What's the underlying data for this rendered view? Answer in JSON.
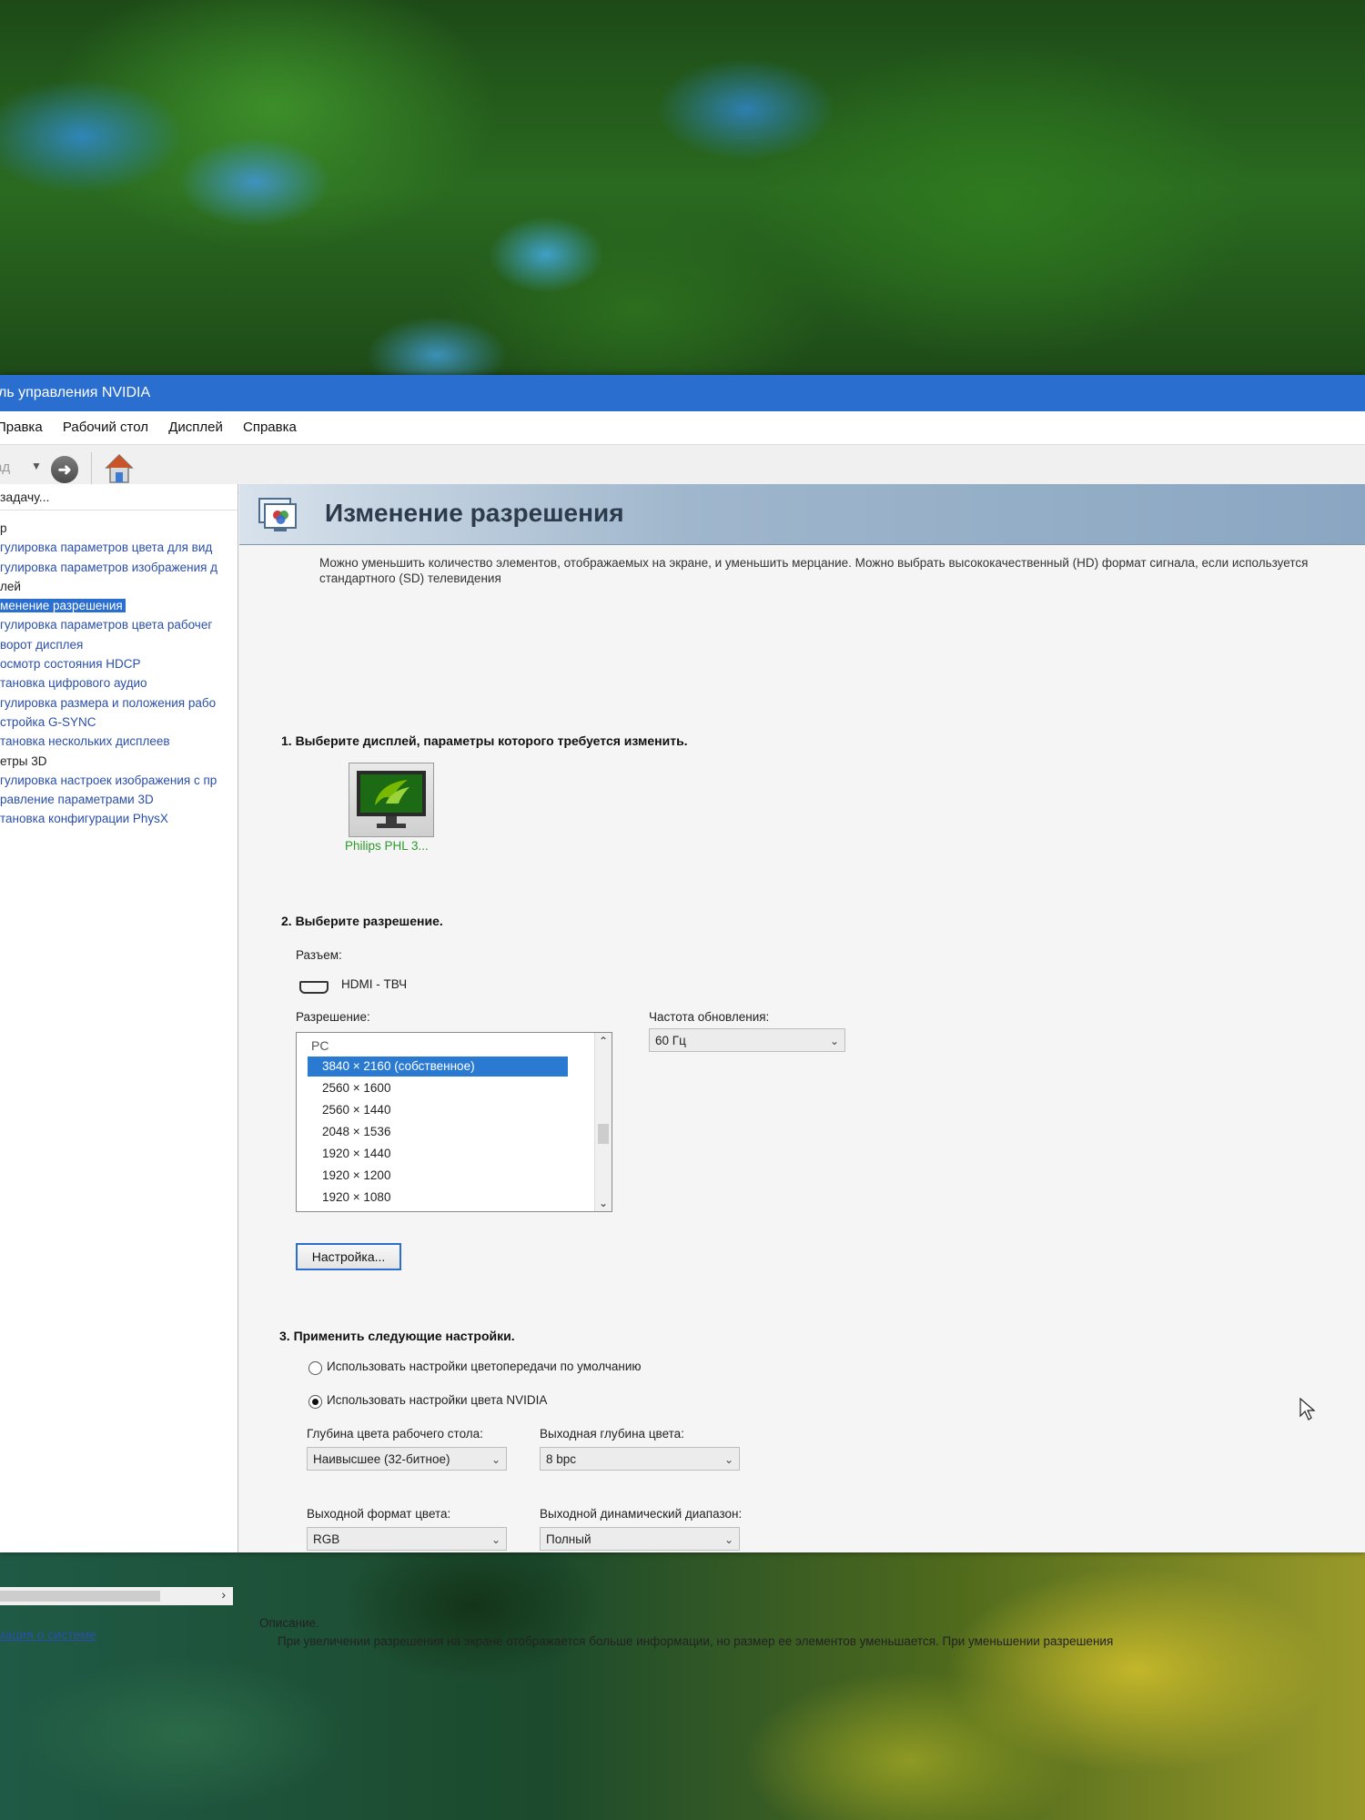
{
  "window": {
    "title": "ль управления NVIDIA"
  },
  "menu": [
    "Правка",
    "Рабочий стол",
    "Дисплей",
    "Справка"
  ],
  "toolbar": {
    "back_label": "ад"
  },
  "nav": {
    "task_label": "задачу...",
    "items": [
      {
        "text": "р",
        "kind": "cat"
      },
      {
        "text": "гулировка параметров цвета для вид",
        "kind": "link"
      },
      {
        "text": "гулировка параметров изображения д",
        "kind": "link"
      },
      {
        "text": "лей",
        "kind": "cat"
      },
      {
        "text": "менение разрешения",
        "kind": "sel"
      },
      {
        "text": "гулировка параметров цвета рабочег",
        "kind": "link"
      },
      {
        "text": "ворот дисплея",
        "kind": "link"
      },
      {
        "text": "осмотр состояния HDCP",
        "kind": "link"
      },
      {
        "text": "тановка цифрового аудио",
        "kind": "link"
      },
      {
        "text": "гулировка размера и положения рабо",
        "kind": "link"
      },
      {
        "text": "стройка G-SYNC",
        "kind": "link"
      },
      {
        "text": "тановка нескольких дисплеев",
        "kind": "link"
      },
      {
        "text": "етры 3D",
        "kind": "cat"
      },
      {
        "text": "гулировка настроек изображения с пр",
        "kind": "link"
      },
      {
        "text": "равление параметрами 3D",
        "kind": "link"
      },
      {
        "text": "тановка конфигурации PhysX",
        "kind": "link"
      }
    ],
    "system_info": "мация о системе"
  },
  "page": {
    "title": "Изменение разрешения",
    "intro": "Можно уменьшить количество элементов, отображаемых на экране, и уменьшить мерцание. Можно выбрать высококачественный (HD) формат сигнала, если используется\nстандартного (SD) телевидения",
    "step1": "1. Выберите дисплей, параметры которого требуется изменить.",
    "display_name": "Philips PHL 3...",
    "step2": "2. Выберите разрешение.",
    "connector_label": "Разъем:",
    "connector_value": "HDMI - ТВЧ",
    "resolution_label": "Разрешение:",
    "resolution_group": "PC",
    "resolutions": [
      {
        "text": "3840 × 2160 (собственное)",
        "selected": true
      },
      {
        "text": "2560 × 1600",
        "selected": false
      },
      {
        "text": "2560 × 1440",
        "selected": false
      },
      {
        "text": "2048 × 1536",
        "selected": false
      },
      {
        "text": "1920 × 1440",
        "selected": false
      },
      {
        "text": "1920 × 1200",
        "selected": false
      },
      {
        "text": "1920 × 1080",
        "selected": false
      }
    ],
    "refresh_label": "Частота обновления:",
    "refresh_value": "60 Гц",
    "customize_button": "Настройка...",
    "step3": "3. Применить следующие настройки.",
    "radio_default": "Использовать настройки цветопередачи по умолчанию",
    "radio_nvidia": "Использовать настройки цвета NVIDIA",
    "radio_selected": "nvidia",
    "desktop_depth_label": "Глубина цвета рабочего стола:",
    "desktop_depth_value": "Наивысшее (32-битное)",
    "output_depth_label": "Выходная глубина цвета:",
    "output_depth_value": "8 bpc",
    "output_format_label": "Выходной формат цвета:",
    "output_format_value": "RGB",
    "dynamic_range_label": "Выходной динамический диапазон:",
    "dynamic_range_value": "Полный",
    "description_label": "Описание.",
    "description_text": "При увеличении разрешения на экране отображается больше информации, но размер ее элементов уменьшается. При уменьшении разрешения"
  },
  "colors": {
    "titlebar": "#2a6fd0",
    "selection": "#2a7ad2",
    "link": "#2b4fa8",
    "nvidia_green": "#76b900"
  }
}
